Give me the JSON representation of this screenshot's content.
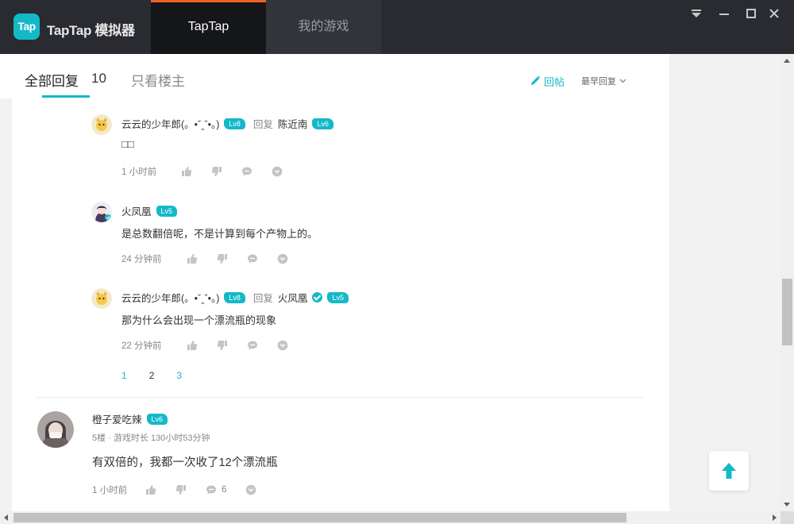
{
  "app": {
    "logo_text": "Tap",
    "name": "TapTap 模拟器",
    "tabs": [
      {
        "label": "TapTap",
        "active": true
      },
      {
        "label": "我的游戏",
        "active": false
      }
    ],
    "accent_color": "#14b9c8",
    "active_tab_indicator_color": "#f06228"
  },
  "header": {
    "all_replies_label": "全部回复",
    "reply_count": "10",
    "op_only_label": "只看楼主",
    "reply_button_label": "回帖",
    "sort_label": "最早回复"
  },
  "sub_replies": [
    {
      "user": "云云的少年郎(。•ˇ‸ˇ•。)",
      "level": "Lv8",
      "reply_word": "回复",
      "reply_to": "陈近南",
      "reply_to_level": "Lv6",
      "reply_to_verified": false,
      "text": "□□",
      "time": "1 小时前"
    },
    {
      "user": "火凤凰",
      "level": "Lv5",
      "text": "是总数翻倍呢，不是计算到每个产物上的。",
      "time": "24 分钟前"
    },
    {
      "user": "云云的少年郎(。•ˇ‸ˇ•。)",
      "level": "Lv8",
      "reply_word": "回复",
      "reply_to": "火凤凰",
      "reply_to_level": "Lv5",
      "reply_to_verified": true,
      "text": "那为什么会出现一个漂流瓶的现象",
      "time": "22 分钟前"
    }
  ],
  "pagination": {
    "pages": [
      "1",
      "2",
      "3"
    ],
    "current": "2"
  },
  "floor_post": {
    "user": "橙子爱吃辣",
    "level": "Lv6",
    "meta": "5楼 · 游戏时长 130小时53分钟",
    "text": "有双倍的，我都一次收了12个漂流瓶",
    "time": "1 小时前",
    "comment_count": "6"
  },
  "icons": {
    "like": "thumbs-up-icon",
    "dislike": "thumbs-down-icon",
    "comment": "comment-bubble-icon",
    "more": "chevron-circle-icon",
    "edit": "pencil-icon",
    "back_to_top": "arrow-up-icon"
  }
}
